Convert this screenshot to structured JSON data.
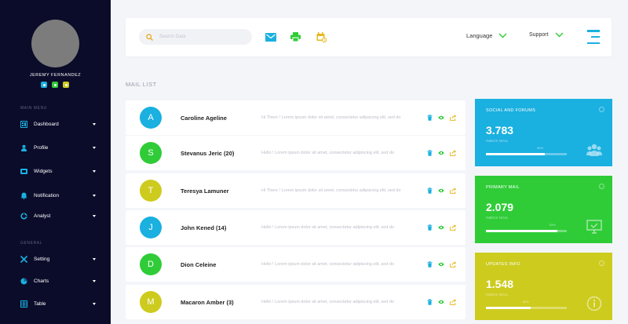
{
  "user": {
    "name": "JEREMY FERNANDEZ",
    "status_colors": [
      "#1ab0e0",
      "#2fcc38",
      "#cdcb1e"
    ]
  },
  "sidebar": {
    "main_menu_label": "MAIN MENU",
    "general_label": "GENERAL",
    "main_items": [
      {
        "label": "Dashboard",
        "icon": "dashboard-icon"
      },
      {
        "label": "Profile",
        "icon": "profile-icon"
      },
      {
        "label": "Widgets",
        "icon": "widgets-icon"
      },
      {
        "label": "Notification",
        "icon": "bell-icon"
      },
      {
        "label": "Analyst",
        "icon": "analyst-icon"
      }
    ],
    "general_items": [
      {
        "label": "Setting",
        "icon": "wrench-icon"
      },
      {
        "label": "Charts",
        "icon": "pie-chart-icon"
      },
      {
        "label": "Table",
        "icon": "table-icon"
      }
    ]
  },
  "topbar": {
    "search_placeholder": "Search Data",
    "language_label": "Language",
    "support_label": "Support",
    "tools": [
      "mail-icon",
      "print-icon",
      "calendar-icon"
    ]
  },
  "mail_list": {
    "title": "MAIL LIST",
    "rows": [
      {
        "initial": "A",
        "name": "Caroline Ageline",
        "preview": "Hi There ! Lorem ipsum dolor sit amet, consectetur adipiscing elit, sed do",
        "color": "#1ab0e0"
      },
      {
        "initial": "S",
        "name": "Stevanus Jeric (20)",
        "preview": "Hello ! Lorem ipsum dolor sit amet, consectetur adipiscing elit, sed do",
        "color": "#2fcc38"
      },
      {
        "initial": "T",
        "name": "Teresya Lamuner",
        "preview": "Hi There ! Lorem ipsum dolor sit amet, consectetur adipiscing elit, sed do",
        "color": "#cdcb1e"
      },
      {
        "initial": "J",
        "name": "John Kened (14)",
        "preview": "Hello ! Lorem ipsum dolor sit amet, consectetur adipiscing elit, sed do",
        "color": "#1ab0e0"
      },
      {
        "initial": "D",
        "name": "Dion Celeine",
        "preview": "Hello ! Lorem ipsum dolor sit amet, consectetur adipiscing elit, sed do",
        "color": "#2fcc38"
      },
      {
        "initial": "M",
        "name": "Macaron Amber (3)",
        "preview": "Hello ! Lorem ipsum dolor sit amet, consectetur adipiscing elit, sed do",
        "color": "#cdcb1e"
      }
    ]
  },
  "stats": [
    {
      "title": "SOCIAL AND FORUMS",
      "value": "3.783",
      "sub": "INBOX MAIL",
      "percent_label": "80%",
      "progress": 0.73,
      "color": "#1ab0e0",
      "icon": "users-icon"
    },
    {
      "title": "PRIMARY MAIL",
      "value": "2.079",
      "sub": "INBOX MAIL",
      "percent_label": "93%",
      "progress": 0.88,
      "color": "#2fcc38",
      "icon": "monitor-icon"
    },
    {
      "title": "UPDATES INFO",
      "value": "1.548",
      "sub": "INBOX MAIL",
      "percent_label": "60%",
      "progress": 0.55,
      "color": "#cdcb1e",
      "icon": "info-icon"
    }
  ]
}
